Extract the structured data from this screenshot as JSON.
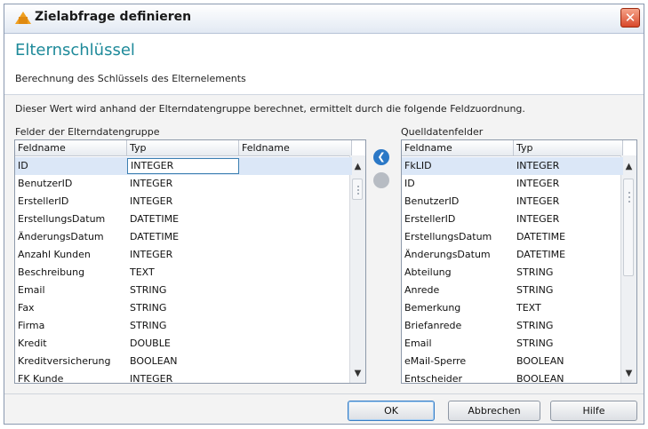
{
  "window": {
    "title": "Zielabfrage definieren",
    "close_glyph": "✕"
  },
  "header": {
    "title": "Elternschlüssel",
    "subtitle": "Berechnung des Schlüssels des Elternelements"
  },
  "description": "Dieser Wert wird anhand der Elterndatengruppe berechnet, ermittelt durch die folgende Feldzuordnung.",
  "left_group": {
    "label": "Felder der Elterndatengruppe",
    "columns": [
      "Feldname",
      "Typ",
      "Feldname"
    ],
    "rows": [
      {
        "name": "ID",
        "type": "INTEGER",
        "mapped": ""
      },
      {
        "name": "BenutzerID",
        "type": "INTEGER",
        "mapped": ""
      },
      {
        "name": "ErstellerID",
        "type": "INTEGER",
        "mapped": ""
      },
      {
        "name": "ErstellungsDatum",
        "type": "DATETIME",
        "mapped": ""
      },
      {
        "name": "ÄnderungsDatum",
        "type": "DATETIME",
        "mapped": ""
      },
      {
        "name": "Anzahl Kunden",
        "type": "INTEGER",
        "mapped": ""
      },
      {
        "name": "Beschreibung",
        "type": "TEXT",
        "mapped": ""
      },
      {
        "name": "Email",
        "type": "STRING",
        "mapped": ""
      },
      {
        "name": "Fax",
        "type": "STRING",
        "mapped": ""
      },
      {
        "name": "Firma",
        "type": "STRING",
        "mapped": ""
      },
      {
        "name": "Kredit",
        "type": "DOUBLE",
        "mapped": ""
      },
      {
        "name": "Kreditversicherung",
        "type": "BOOLEAN",
        "mapped": ""
      },
      {
        "name": "FK Kunde",
        "type": "INTEGER",
        "mapped": ""
      }
    ]
  },
  "right_group": {
    "label": "Quelldatenfelder",
    "columns": [
      "Feldname",
      "Typ"
    ],
    "rows": [
      {
        "name": "FkLID",
        "type": "INTEGER"
      },
      {
        "name": "ID",
        "type": "INTEGER"
      },
      {
        "name": "BenutzerID",
        "type": "INTEGER"
      },
      {
        "name": "ErstellerID",
        "type": "INTEGER"
      },
      {
        "name": "ErstellungsDatum",
        "type": "DATETIME"
      },
      {
        "name": "ÄnderungsDatum",
        "type": "DATETIME"
      },
      {
        "name": "Abteilung",
        "type": "STRING"
      },
      {
        "name": "Anrede",
        "type": "STRING"
      },
      {
        "name": "Bemerkung",
        "type": "TEXT"
      },
      {
        "name": "Briefanrede",
        "type": "STRING"
      },
      {
        "name": "Email",
        "type": "STRING"
      },
      {
        "name": "eMail-Sperre",
        "type": "BOOLEAN"
      },
      {
        "name": "Entscheider",
        "type": "BOOLEAN"
      }
    ]
  },
  "mid_buttons": {
    "assign_glyph": "❮"
  },
  "buttons": {
    "ok": "OK",
    "cancel": "Abbrechen",
    "help": "Hilfe"
  },
  "icons": {
    "title": "app-icon",
    "close": "close-icon",
    "assign": "arrow-left-icon",
    "remove": "remove-icon"
  },
  "colors": {
    "header_title": "#1e8a9a",
    "selection": "#dbe7f7",
    "assign_button": "#2b78c6",
    "close_button": "#d8482a"
  }
}
